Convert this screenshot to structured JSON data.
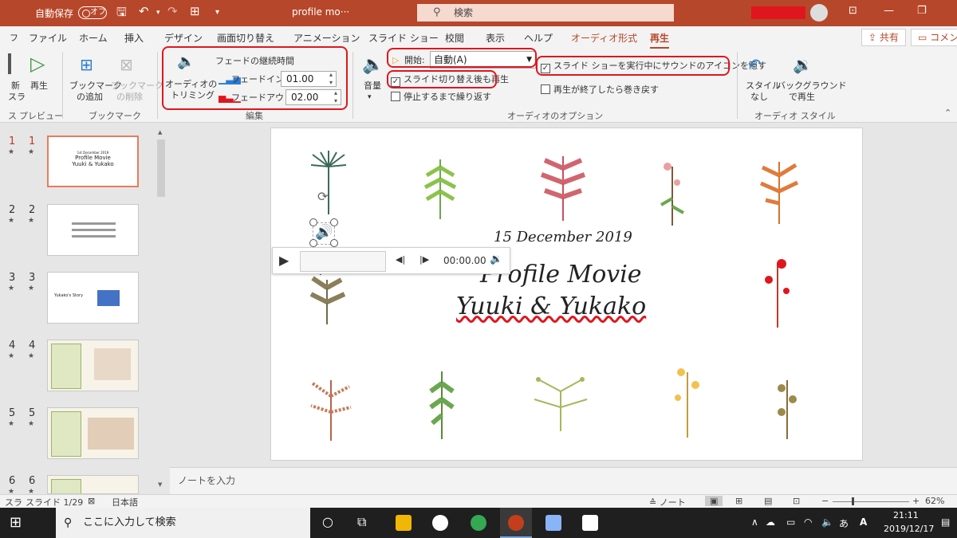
{
  "titlebar": {
    "autosave_label": "自動保存",
    "autosave_state": "オフ",
    "file_title": "profile mo···",
    "search_placeholder": "検索"
  },
  "tabs": [
    "ファイル",
    "ホーム",
    "挿入",
    "デザイン",
    "画面切り替え",
    "アニメーション",
    "スライド ショー",
    "校閲",
    "表示",
    "ヘルプ",
    "オーディオ形式",
    "再生"
  ],
  "share_label": "共有",
  "comment_label": "コメント",
  "ribbon": {
    "preview": {
      "new_label": "新",
      "new_label2": "スラ",
      "play_label": "再生",
      "group": "プレビュー",
      "group_prefix": "ス"
    },
    "bookmark": {
      "add_label": "ブックマーク",
      "add_label2": "の追加",
      "del_label": "ブックマーク",
      "del_label2": "の削除",
      "group": "ブックマーク"
    },
    "edit": {
      "trim_label": "オーディオの",
      "trim_label2": "トリミング",
      "fade_title": "フェードの継続時間",
      "fade_in_label": "フェードイン:",
      "fade_in_value": "01.00",
      "fade_out_label": "フェードアウト:",
      "fade_out_value": "02.00",
      "group": "編集"
    },
    "options": {
      "volume_label": "音量",
      "start_label": "開始:",
      "start_value": "自動(A)",
      "across_slides": "スライド切り替え後も再生",
      "loop": "停止するまで繰り返す",
      "hide_during_show": "スライド ショーを実行中にサウンドのアイコンを隠す",
      "rewind": "再生が終了したら巻き戻す",
      "group": "オーディオのオプション"
    },
    "style": {
      "none_label": "スタイル",
      "none_label2": "なし",
      "bg_label": "バックグラウンド",
      "bg_label2": "で再生",
      "group": "オーディオ スタイル"
    }
  },
  "slides": [
    {
      "n": "1"
    },
    {
      "n": "2"
    },
    {
      "n": "3"
    },
    {
      "n": "4"
    },
    {
      "n": "5"
    },
    {
      "n": "6"
    }
  ],
  "slide": {
    "date": "15 December 2019",
    "title1": "Profile Movie",
    "title2": "Yuuki & Yukako"
  },
  "thumb1": {
    "small": "1st December 2019",
    "t1": "Profile Movie",
    "t2": "Yuuki & Yukako"
  },
  "thumb3": {
    "label": "Yukako's Story"
  },
  "player": {
    "time": "00:00.00"
  },
  "notes_placeholder": "ノートを入力",
  "status": {
    "slide": "スライド 1/29",
    "lang": "日本語",
    "prefix": "スラ",
    "notes": "ノート",
    "zoom": "62%"
  },
  "taskbar": {
    "search": "ここに入力して検索",
    "time": "21:11",
    "date": "2019/12/17",
    "ime": "あ"
  }
}
